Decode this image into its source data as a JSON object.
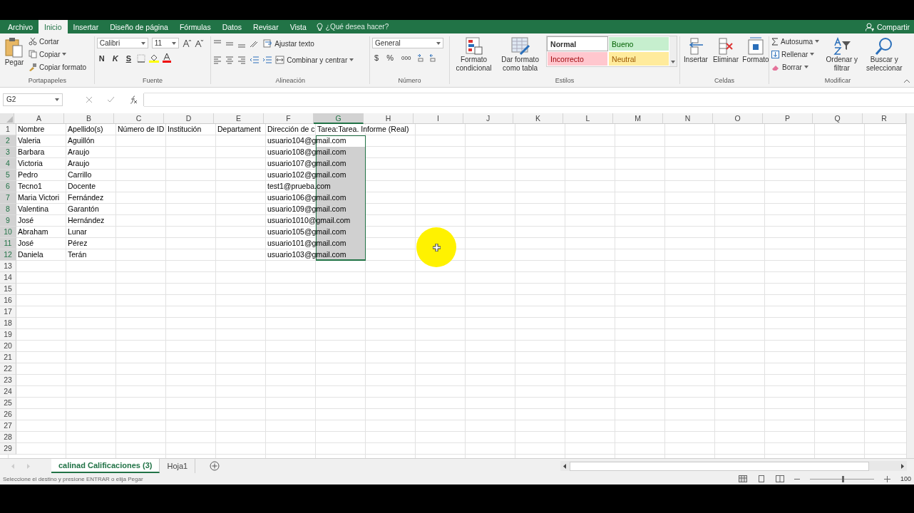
{
  "menu_tabs": [
    {
      "label": "Archivo",
      "selected": false
    },
    {
      "label": "Inicio",
      "selected": true
    },
    {
      "label": "Insertar",
      "selected": false
    },
    {
      "label": "Diseño de página",
      "selected": false
    },
    {
      "label": "Fórmulas",
      "selected": false
    },
    {
      "label": "Datos",
      "selected": false
    },
    {
      "label": "Revisar",
      "selected": false
    },
    {
      "label": "Vista",
      "selected": false
    }
  ],
  "tell_me": {
    "placeholder": "¿Qué desea hacer?"
  },
  "share": "Compartir",
  "clipboard": {
    "title": "Portapapeles",
    "paste": "Pegar",
    "cut": "Cortar",
    "copy": "Copiar",
    "format_painter": "Copiar formato"
  },
  "font": {
    "title": "Fuente",
    "family": "Calibri",
    "size": "11",
    "bold": "N",
    "italic": "K",
    "underline": "S"
  },
  "alignment": {
    "title": "Alineación",
    "wrap": "Ajustar texto",
    "merge": "Combinar y centrar"
  },
  "number": {
    "title": "Número",
    "format": "General",
    "currency": "$",
    "percent": "%",
    "thousands": "000"
  },
  "styles": {
    "title": "Estilos",
    "conditional": [
      "Formato",
      "condicional"
    ],
    "as_table": [
      "Dar formato",
      "como tabla"
    ],
    "cells": [
      {
        "label": "Normal",
        "color": "#ffffff"
      },
      {
        "label": "Bueno",
        "color": "#c6efce"
      },
      {
        "label": "Incorrecto",
        "color": "#ffc7ce"
      },
      {
        "label": "Neutral",
        "color": "#ffeb9c"
      }
    ]
  },
  "cells_group": {
    "title": "Celdas",
    "insert": "Insertar",
    "delete": "Eliminar",
    "format": "Formato"
  },
  "editing": {
    "title": "Modificar",
    "autosum": "Autosuma",
    "fill": "Rellenar",
    "clear": "Borrar",
    "sort": [
      "Ordenar y",
      "filtrar"
    ],
    "find": [
      "Buscar y",
      "seleccionar"
    ]
  },
  "name_box": "G2",
  "columns": [
    {
      "letter": "A",
      "selected": false
    },
    {
      "letter": "B",
      "selected": false
    },
    {
      "letter": "C",
      "selected": false
    },
    {
      "letter": "D",
      "selected": false
    },
    {
      "letter": "E",
      "selected": false
    },
    {
      "letter": "F",
      "selected": false
    },
    {
      "letter": "G",
      "selected": true
    },
    {
      "letter": "H",
      "selected": false
    },
    {
      "letter": "I",
      "selected": false
    },
    {
      "letter": "J",
      "selected": false
    },
    {
      "letter": "K",
      "selected": false
    },
    {
      "letter": "L",
      "selected": false
    },
    {
      "letter": "M",
      "selected": false
    },
    {
      "letter": "N",
      "selected": false
    },
    {
      "letter": "O",
      "selected": false
    },
    {
      "letter": "P",
      "selected": false
    },
    {
      "letter": "Q",
      "selected": false
    },
    {
      "letter": "R",
      "selected": false
    }
  ],
  "rows": [
    {
      "number": "1",
      "selected": false,
      "cells": {
        "A": "Nombre",
        "B": "Apellido(s)",
        "C": "Número de ID",
        "D": "Institución",
        "E": "Departament",
        "F": "Dirección de c",
        "G": "Tarea:Tarea. Informe (Real)"
      }
    },
    {
      "number": "2",
      "selected": true,
      "cells": {
        "A": "Valeria",
        "B": "Aguillón",
        "F": "usuario104@gmail.com"
      }
    },
    {
      "number": "3",
      "selected": true,
      "cells": {
        "A": "Barbara",
        "B": "Araujo",
        "F": "usuario108@gmail.com"
      }
    },
    {
      "number": "4",
      "selected": true,
      "cells": {
        "A": "Victoria",
        "B": "Araujo",
        "F": "usuario107@gmail.com"
      }
    },
    {
      "number": "5",
      "selected": true,
      "cells": {
        "A": "Pedro",
        "B": "Carrillo",
        "F": "usuario102@gmail.com"
      }
    },
    {
      "number": "6",
      "selected": true,
      "cells": {
        "A": "Tecno1",
        "B": "Docente",
        "F": "test1@prueba.com"
      }
    },
    {
      "number": "7",
      "selected": true,
      "cells": {
        "A": "Maria Victori",
        "B": "Fernández",
        "F": "usuario106@gmail.com"
      }
    },
    {
      "number": "8",
      "selected": true,
      "cells": {
        "A": "Valentina",
        "B": "Garantón",
        "F": "usuario109@gmail.com"
      }
    },
    {
      "number": "9",
      "selected": true,
      "cells": {
        "A": "José",
        "B": "Hernández",
        "F": "usuario1010@gmail.com"
      }
    },
    {
      "number": "10",
      "selected": true,
      "cells": {
        "A": "Abraham",
        "B": "Lunar",
        "F": "usuario105@gmail.com"
      }
    },
    {
      "number": "11",
      "selected": true,
      "cells": {
        "A": "José",
        "B": "Pérez",
        "F": "usuario101@gmail.com"
      }
    },
    {
      "number": "12",
      "selected": true,
      "cells": {
        "A": "Daniela",
        "B": "Terán",
        "F": "usuario103@gmail.com"
      }
    },
    {
      "number": "13",
      "selected": false
    },
    {
      "number": "14",
      "selected": false
    },
    {
      "number": "15",
      "selected": false
    },
    {
      "number": "16",
      "selected": false
    },
    {
      "number": "17",
      "selected": false
    },
    {
      "number": "18",
      "selected": false
    },
    {
      "number": "19",
      "selected": false
    },
    {
      "number": "20",
      "selected": false
    },
    {
      "number": "21",
      "selected": false
    },
    {
      "number": "22",
      "selected": false
    },
    {
      "number": "23",
      "selected": false
    },
    {
      "number": "24",
      "selected": false
    },
    {
      "number": "25",
      "selected": false
    },
    {
      "number": "26",
      "selected": false
    },
    {
      "number": "27",
      "selected": false
    },
    {
      "number": "28",
      "selected": false
    },
    {
      "number": "29",
      "selected": false
    }
  ],
  "sheet_tabs": [
    {
      "label": "calinad Calificaciones (3)",
      "selected": true
    },
    {
      "label": "Hoja1",
      "selected": false
    }
  ],
  "status_bar": {
    "message": "Seleccione el destino y presione ENTRAR o elija Pegar",
    "zoom": {
      "level": 0.5,
      "reading": "100"
    }
  }
}
